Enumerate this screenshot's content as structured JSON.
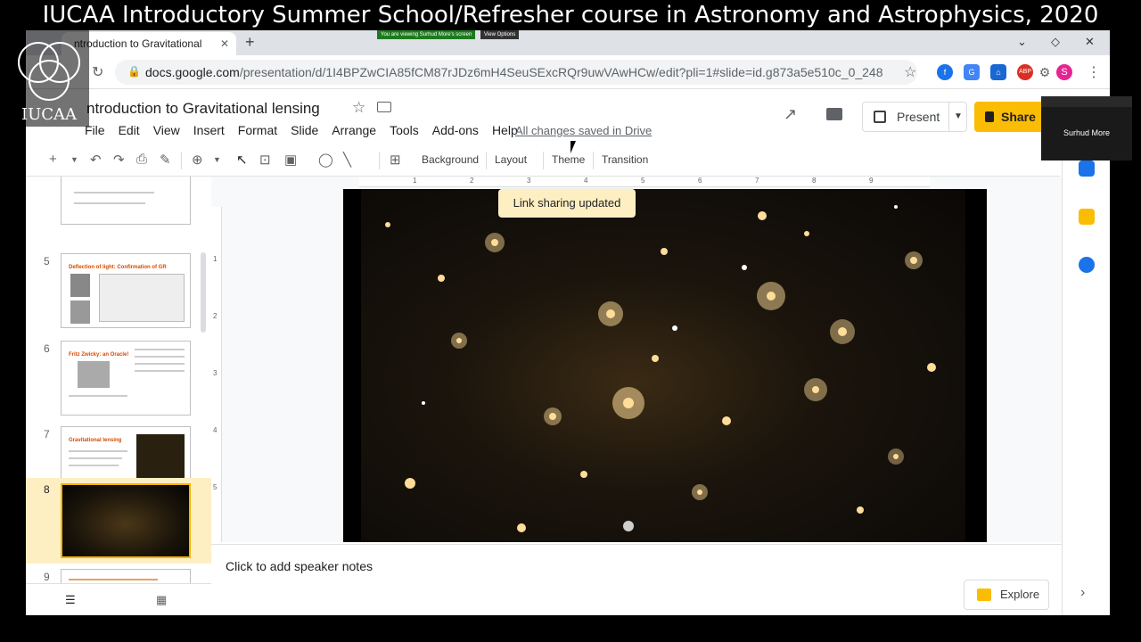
{
  "banner": {
    "text": "IUCAA Introductory Summer School/Refresher course in Astronomy and Astrophysics, 2020"
  },
  "logo": {
    "text": "IUCAA"
  },
  "browser": {
    "tab_title": "ntroduction to Gravitational",
    "new_tab": "+",
    "viewing_bar": "You are viewing Surhud More's screen",
    "view_options": "View Options",
    "url_host": "docs.google.com",
    "url_path": "/presentation/d/1I4BPZwCIA85fCM87rJDz6mH4SeuSExcRQr9uwVAwHCw/edit?pli=1#slide=id.g873a5e510c_0_248",
    "profile": "S",
    "ext_abp": "ABP"
  },
  "doc": {
    "title": "ntroduction to  Gravitational lensing",
    "menu": [
      "File",
      "Edit",
      "View",
      "Insert",
      "Format",
      "Slide",
      "Arrange",
      "Tools",
      "Add-ons",
      "Help"
    ],
    "saved": "All changes saved in Drive",
    "present": "Present",
    "share": "Share"
  },
  "toolbar": {
    "background": "Background",
    "layout": "Layout",
    "theme": "Theme",
    "transition": "Transition"
  },
  "ruler": {
    "h": [
      "1",
      "2",
      "3",
      "4",
      "5",
      "6",
      "7",
      "8",
      "9"
    ],
    "v": [
      "1",
      "2",
      "3",
      "4",
      "5"
    ]
  },
  "slides": [
    {
      "num": "5",
      "title": "Deflection of light: Confirmation of GR"
    },
    {
      "num": "6",
      "title": "Fritz Zwicky: an Oracle!"
    },
    {
      "num": "7",
      "title": "Gravitational lensing"
    },
    {
      "num": "8",
      "title": ""
    },
    {
      "num": "9",
      "title": ""
    }
  ],
  "toast": "Link sharing updated",
  "notes": {
    "placeholder": "Click to add speaker notes",
    "explore": "Explore"
  },
  "zoom_participant": {
    "name": "Surhud More"
  },
  "colors": {
    "accent": "#fbbc04",
    "selection": "#feefc3",
    "slide_bg": "#000000"
  }
}
